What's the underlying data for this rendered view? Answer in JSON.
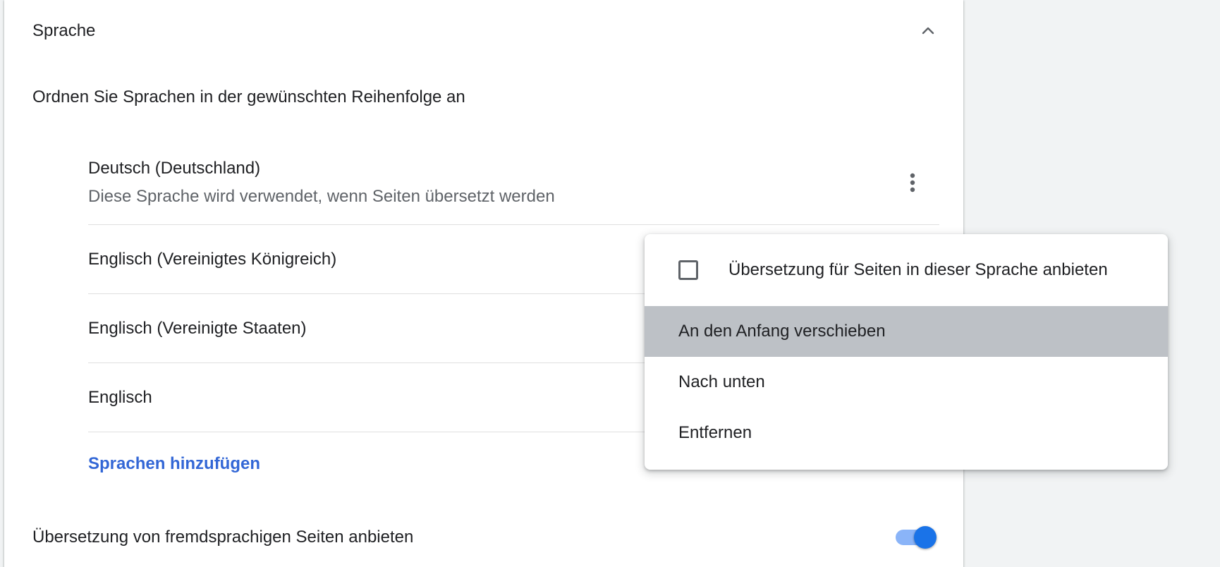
{
  "section": {
    "title": "Sprache",
    "collapse_icon": "chevron-up-icon"
  },
  "subtitle": "Ordnen Sie Sprachen in der gewünschten Reihenfolge an",
  "languages": [
    {
      "name": "Deutsch (Deutschland)",
      "note": "Diese Sprache wird verwendet, wenn Seiten übersetzt werden"
    },
    {
      "name": "Englisch (Vereinigtes Königreich)"
    },
    {
      "name": "Englisch (Vereinigte Staaten)"
    },
    {
      "name": "Englisch"
    }
  ],
  "add_languages_label": "Sprachen hinzufügen",
  "translate_offer": {
    "label": "Übersetzung von fremdsprachigen Seiten anbieten",
    "enabled": true
  },
  "context_menu": {
    "checkbox_label": "Übersetzung für Seiten in dieser Sprache anbieten",
    "checkbox_checked": false,
    "items": [
      {
        "label": "An den Anfang verschieben",
        "highlighted": true
      },
      {
        "label": "Nach unten"
      },
      {
        "label": "Entfernen"
      }
    ]
  },
  "colors": {
    "link": "#3367d6",
    "toggle_on": "#1a73e8",
    "menu_highlight": "#bdc1c6"
  }
}
